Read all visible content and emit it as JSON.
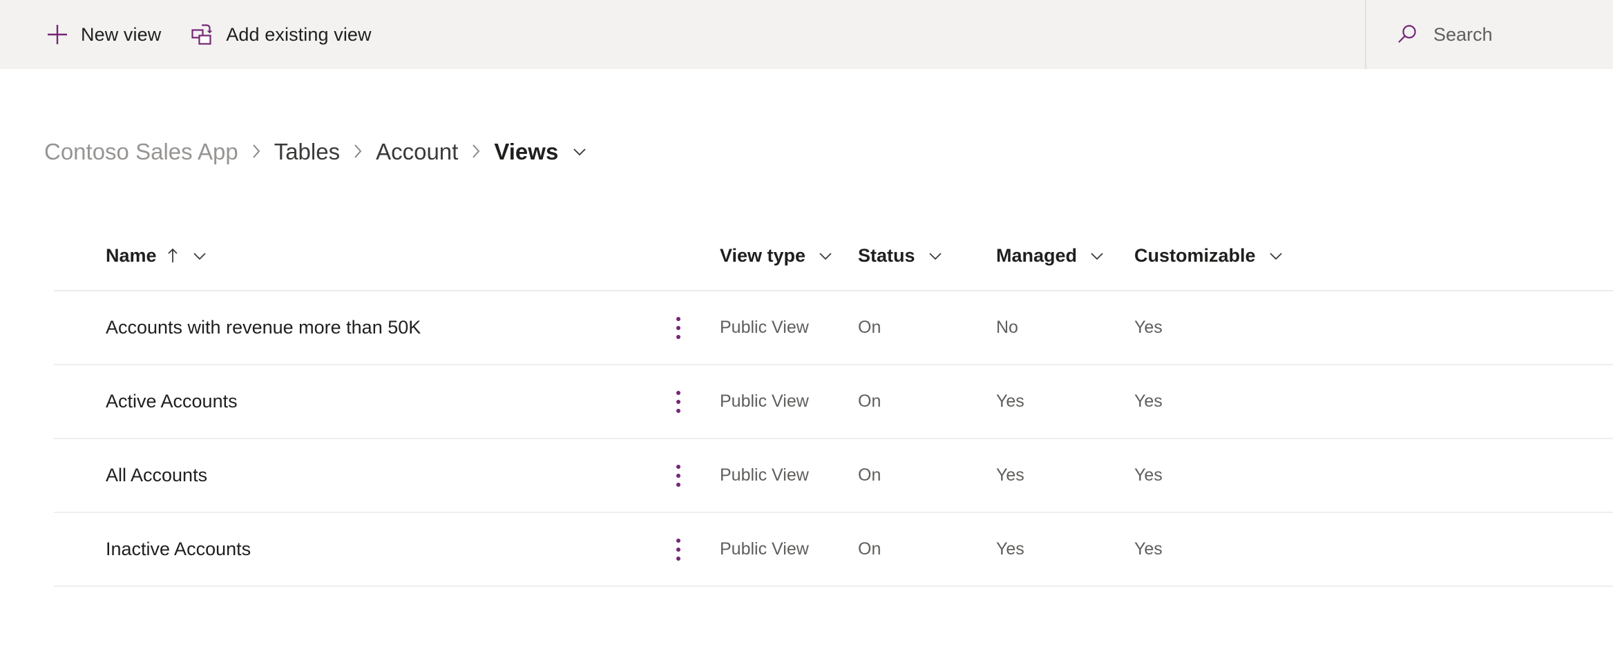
{
  "theme": {
    "accent_purple": "#742774",
    "command_bar_bg": "#f3f2f1",
    "page_bg": "#ffffff",
    "divider": "#f0eeed",
    "text_primary": "#201f1e",
    "text_secondary": "#605e5c",
    "breadcrumb_muted": "#979593"
  },
  "command_bar": {
    "new_view": {
      "label": "New view",
      "icon": "plus-icon"
    },
    "add_existing_view": {
      "label": "Add existing view",
      "icon": "add-existing-view-icon"
    }
  },
  "search": {
    "placeholder": "Search",
    "icon": "search-icon",
    "value": ""
  },
  "breadcrumb": {
    "items": [
      {
        "label": "Contoso Sales App",
        "current": false
      },
      {
        "label": "Tables",
        "current": false
      },
      {
        "label": "Account",
        "current": false
      },
      {
        "label": "Views",
        "current": true
      }
    ],
    "separator": "›",
    "caret_icon": "chevron-down-icon"
  },
  "table": {
    "columns": [
      {
        "key": "name",
        "label": "Name",
        "sorted": "ascending",
        "sort_icon": "arrow-up-icon",
        "caret_icon": "chevron-down-icon"
      },
      {
        "key": "view_type",
        "label": "View type",
        "sorted": "none",
        "caret_icon": "chevron-down-icon"
      },
      {
        "key": "status",
        "label": "Status",
        "sorted": "none",
        "caret_icon": "chevron-down-icon"
      },
      {
        "key": "managed",
        "label": "Managed",
        "sorted": "none",
        "caret_icon": "chevron-down-icon"
      },
      {
        "key": "customizable",
        "label": "Customizable",
        "sorted": "none",
        "caret_icon": "chevron-down-icon"
      }
    ],
    "row_menu_icon": "more-options-icon",
    "rows": [
      {
        "name": "Accounts with revenue more than 50K",
        "view_type": "Public View",
        "status": "On",
        "managed": "No",
        "customizable": "Yes"
      },
      {
        "name": "Active Accounts",
        "view_type": "Public View",
        "status": "On",
        "managed": "Yes",
        "customizable": "Yes"
      },
      {
        "name": "All Accounts",
        "view_type": "Public View",
        "status": "On",
        "managed": "Yes",
        "customizable": "Yes"
      },
      {
        "name": "Inactive Accounts",
        "view_type": "Public View",
        "status": "On",
        "managed": "Yes",
        "customizable": "Yes"
      }
    ]
  }
}
